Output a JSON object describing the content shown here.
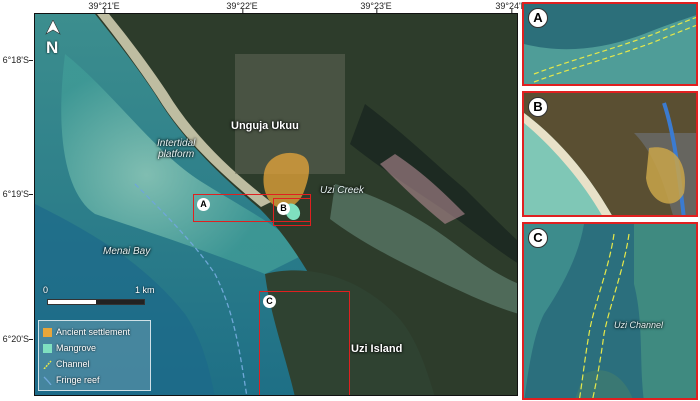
{
  "map": {
    "longitude_ticks": [
      "39°21'E",
      "39°22'E",
      "39°23'E",
      "39°24'E"
    ],
    "latitude_ticks": [
      "6°18'S",
      "6°19'S",
      "6°20'S"
    ],
    "north_label": "N",
    "scale": {
      "start": "0",
      "end": "1 km"
    },
    "place_labels": {
      "town": "Unguja Ukuu",
      "intertidal": "Intertidal\nplatform",
      "creek": "Uzi Creek",
      "bay": "Menai Bay",
      "island": "Uzi Island"
    },
    "boxes": [
      "A",
      "B",
      "C"
    ],
    "legend": [
      {
        "label": "Ancient settlement",
        "color": "#e8a63a"
      },
      {
        "label": "Mangrove",
        "color": "#7fe0c0"
      },
      {
        "label": "Channel",
        "color": "#e6e84a"
      },
      {
        "label": "Fringe reef",
        "color": "#6fa8d8"
      }
    ]
  },
  "insets": [
    {
      "tag": "A"
    },
    {
      "tag": "B"
    },
    {
      "tag": "C",
      "label": "Uzi Channel"
    }
  ],
  "colors": {
    "frame_red": "#e02020",
    "sea": "#2f7f8c",
    "land": "#2e3f2f"
  }
}
